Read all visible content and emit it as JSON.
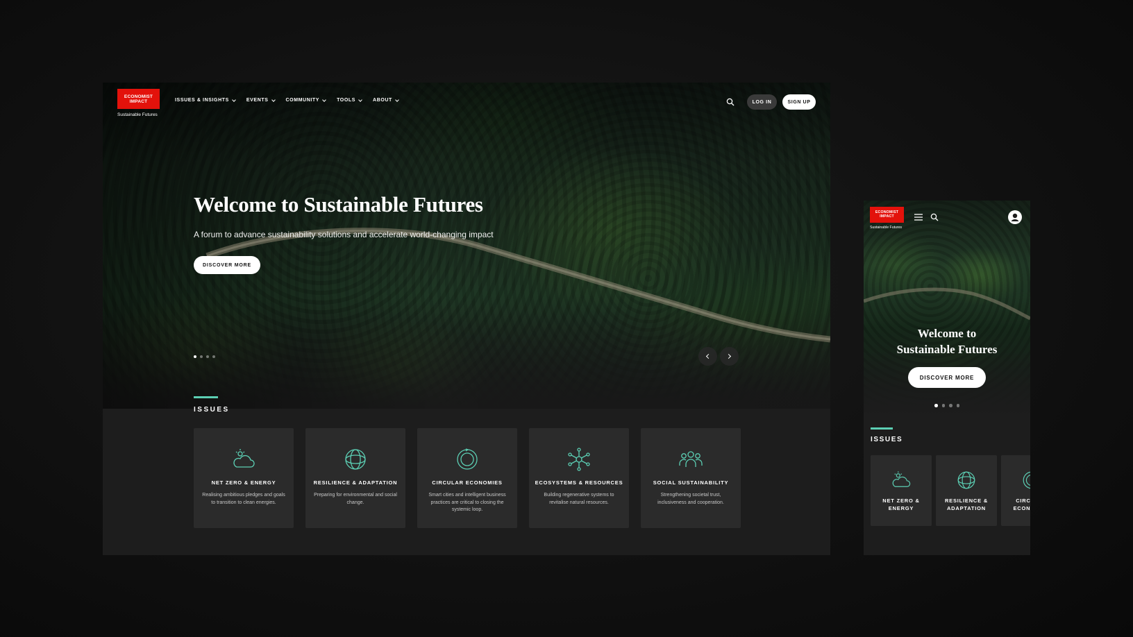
{
  "brand": {
    "logo_line": "ECONOMIST IMPACT",
    "subtitle": "Sustainable Futures",
    "color": "#e3120b"
  },
  "accent_color": "#5ccfb4",
  "nav": {
    "items": [
      {
        "label": "ISSUES & INSIGHTS"
      },
      {
        "label": "EVENTS"
      },
      {
        "label": "COMMUNITY"
      },
      {
        "label": "TOOLS"
      },
      {
        "label": "ABOUT"
      }
    ],
    "search_icon": "search-icon",
    "login_label": "LOG IN",
    "signup_label": "SIGN UP"
  },
  "hero": {
    "title": "Welcome to Sustainable Futures",
    "subtitle": "A forum to advance sustainability solutions and accelerate world-changing impact",
    "cta": "DISCOVER MORE",
    "slides": 4,
    "active_slide": 1
  },
  "issues": {
    "heading": "ISSUES",
    "cards": [
      {
        "icon": "cloud-sun-icon",
        "title": "NET ZERO & ENERGY",
        "description": "Realising ambitious pledges and goals to transition to clean energies."
      },
      {
        "icon": "globe-sphere-icon",
        "title": "RESILIENCE & ADAPTATION",
        "description": "Preparing for environmental and social change."
      },
      {
        "icon": "circular-loop-icon",
        "title": "CIRCULAR ECONOMIES",
        "description": "Smart cities and intelligent business practices are critical to closing the systemic loop."
      },
      {
        "icon": "network-nodes-icon",
        "title": "ECOSYSTEMS & RESOURCES",
        "description": "Building regenerative systems to revitalise natural resources."
      },
      {
        "icon": "people-group-icon",
        "title": "SOCIAL SUSTAINABILITY",
        "description": "Strengthening societal trust, inclusiveness and cooperation."
      }
    ]
  },
  "mobile": {
    "hero_title_line1": "Welcome to",
    "hero_title_line2": "Sustainable Futures",
    "cta": "DISCOVER MORE",
    "issues_heading": "ISSUES",
    "cards": [
      {
        "line1": "NET ZERO &",
        "line2": "ENERGY"
      },
      {
        "line1": "RESILIENCE &",
        "line2": "ADAPTATION"
      },
      {
        "line1": "CIRCULAR",
        "line2": "ECONOMIES"
      }
    ]
  }
}
